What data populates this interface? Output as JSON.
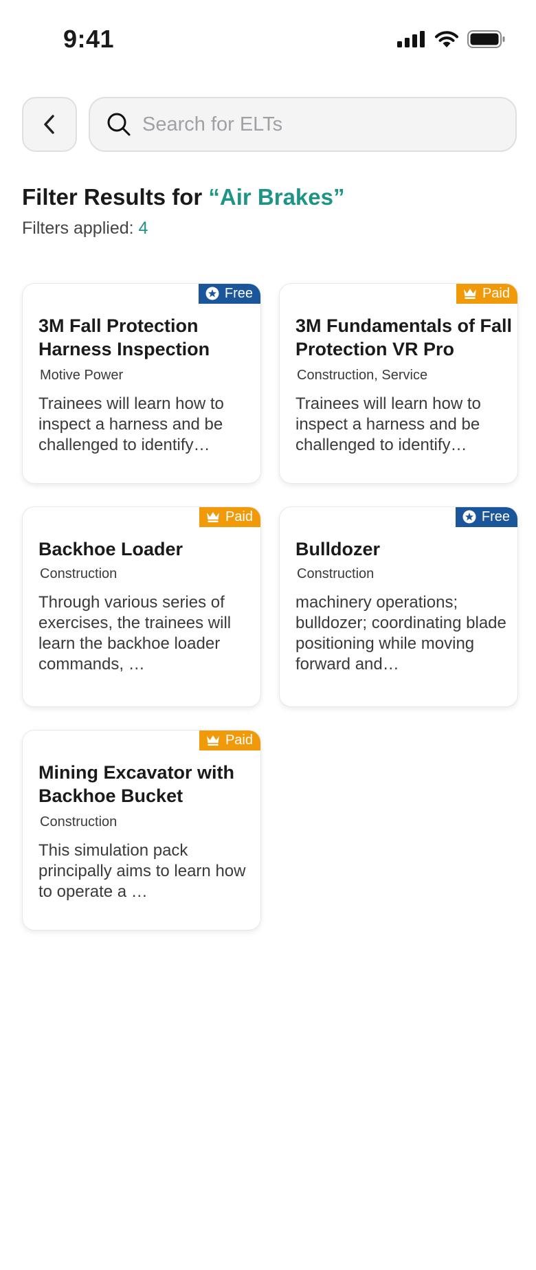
{
  "status": {
    "time": "9:41"
  },
  "search": {
    "placeholder": "Search for ELTs"
  },
  "heading": {
    "prefix": "Filter Results for ",
    "query": "“Air Brakes”"
  },
  "filters": {
    "label": "Filters applied: ",
    "count": "4"
  },
  "colors": {
    "accent": "#1e9486",
    "free_badge": "#1a5699",
    "paid_badge": "#f09a0a"
  },
  "cards": [
    {
      "badge": "Free",
      "badge_icon": "star-circle-icon",
      "title": "3M Fall Protection Harness Inspection",
      "category": "Motive Power",
      "description": "Trainees will learn how to inspect a harness and be challenged to identify…"
    },
    {
      "badge": "Paid",
      "badge_icon": "crown-icon",
      "title": "3M Fundamentals of Fall Protection VR Pro",
      "category": "Construction, Service",
      "description": "Trainees will learn how to inspect a harness and be challenged to identify…"
    },
    {
      "badge": "Paid",
      "badge_icon": "crown-icon",
      "title": "Backhoe Loader",
      "category": "Construction",
      "description": "Through various series of exercises, the trainees will learn the backhoe loader commands, …"
    },
    {
      "badge": "Free",
      "badge_icon": "star-circle-icon",
      "title": "Bulldozer",
      "category": "Construction",
      "description": "machinery operations; bulldozer; coordinating blade positioning while moving forward and…"
    },
    {
      "badge": "Paid",
      "badge_icon": "crown-icon",
      "title": "Mining Excavator with Backhoe Bucket",
      "category": "Construction",
      "description": "This simulation pack principally aims to learn how to operate a …"
    }
  ]
}
